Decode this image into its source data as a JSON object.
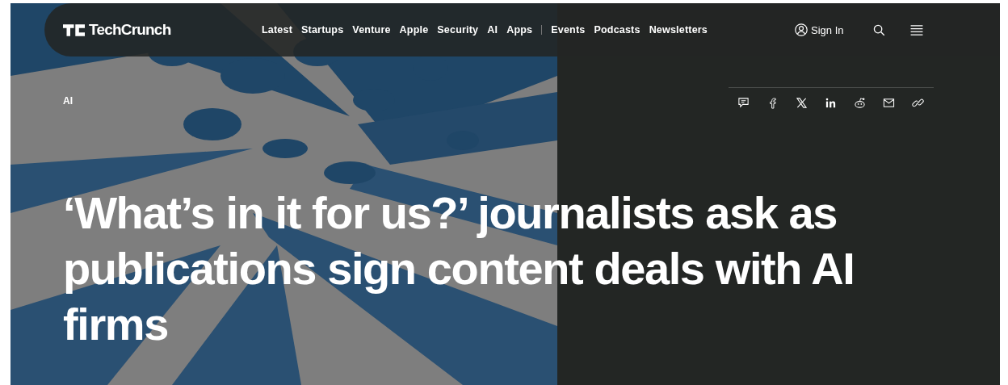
{
  "logo": {
    "text": "TechCrunch"
  },
  "nav_sections": [
    "Latest",
    "Startups",
    "Venture",
    "Apple",
    "Security",
    "AI",
    "Apps"
  ],
  "nav_more": [
    "Events",
    "Podcasts",
    "Newsletters"
  ],
  "sign_in": "Sign In",
  "category": "AI",
  "share": [
    {
      "kind": "comment"
    },
    {
      "kind": "facebook"
    },
    {
      "kind": "x"
    },
    {
      "kind": "linkedin"
    },
    {
      "kind": "reddit"
    },
    {
      "kind": "email"
    },
    {
      "kind": "link"
    }
  ],
  "headline": "‘What’s in it for us?’ journalists ask as publications sign content deals with AI firms"
}
